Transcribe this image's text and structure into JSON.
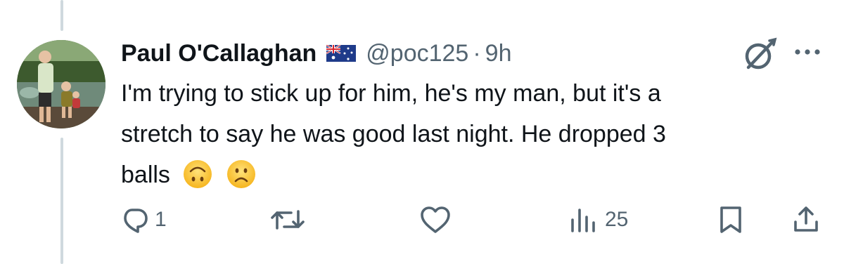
{
  "tweet": {
    "display_name": "Paul O'Callaghan",
    "handle": "@poc125",
    "separator": "·",
    "time": "9h",
    "flag_icon": "australia-flag-icon",
    "text_lines": [
      "I'm trying to stick up for him, he's my man, but it's a",
      "stretch to say he was good last night. He dropped 3",
      "balls"
    ],
    "emojis": [
      "upside-down-face-emoji",
      "slightly-frowning-face-emoji"
    ]
  },
  "actions": {
    "reply_count": "1",
    "retweet_count": "",
    "like_count": "",
    "views_count": "25"
  },
  "colors": {
    "text_primary": "#0f1419",
    "text_secondary": "#536471",
    "thread_line": "#cfd9de"
  },
  "icons": {
    "grok": "grok-icon",
    "more": "more-dots-icon",
    "reply": "reply-icon",
    "retweet": "retweet-icon",
    "like": "heart-icon",
    "views": "views-icon",
    "bookmark": "bookmark-icon",
    "share": "share-icon"
  }
}
